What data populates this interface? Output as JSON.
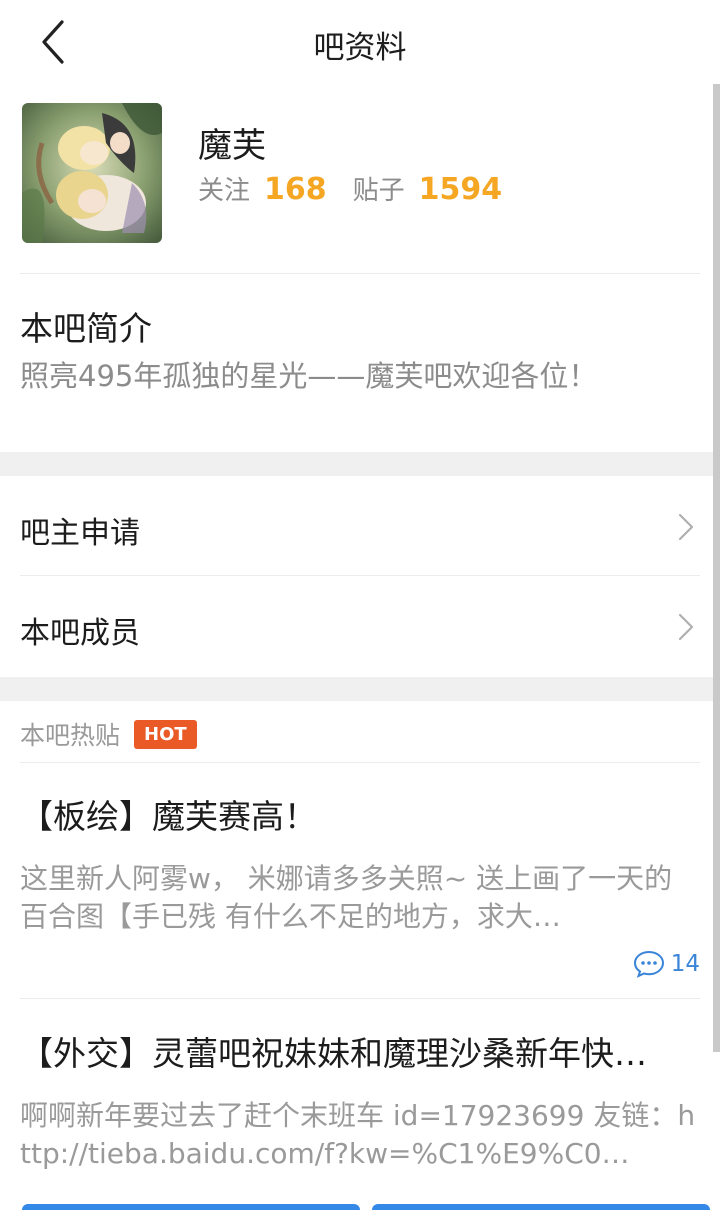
{
  "header": {
    "title": "吧资料",
    "back_icon": "chevron-left-icon"
  },
  "profile": {
    "name": "魔芙",
    "follow_label": "关注",
    "follow_count": "168",
    "posts_label": "贴子",
    "posts_count": "1594"
  },
  "intro": {
    "title": "本吧简介",
    "text": "照亮495年孤独的星光——魔芙吧欢迎各位！"
  },
  "menu": [
    {
      "label": "吧主申请"
    },
    {
      "label": "本吧成员"
    }
  ],
  "hot": {
    "title": "本吧热贴",
    "badge": "HOT",
    "posts": [
      {
        "title": "【板绘】魔芙赛高！",
        "excerpt": "这里新人阿雾w， 米娜请多多关照~ 送上画了一天的百合图【手已残 有什么不足的地方，求大…",
        "comments": "14"
      },
      {
        "title": "【外交】灵蕾吧祝妹妹和魔理沙桑新年快…",
        "excerpt": "啊啊新年要过去了赶个末班车 id=17923699 友链：http://tieba.baidu.com/f?kw=%C1%E9%C0…"
      }
    ]
  },
  "colors": {
    "accent": "#f5a623",
    "hot_badge": "#e95a27",
    "link_blue": "#3a85d8",
    "button_blue": "#3388e8"
  }
}
